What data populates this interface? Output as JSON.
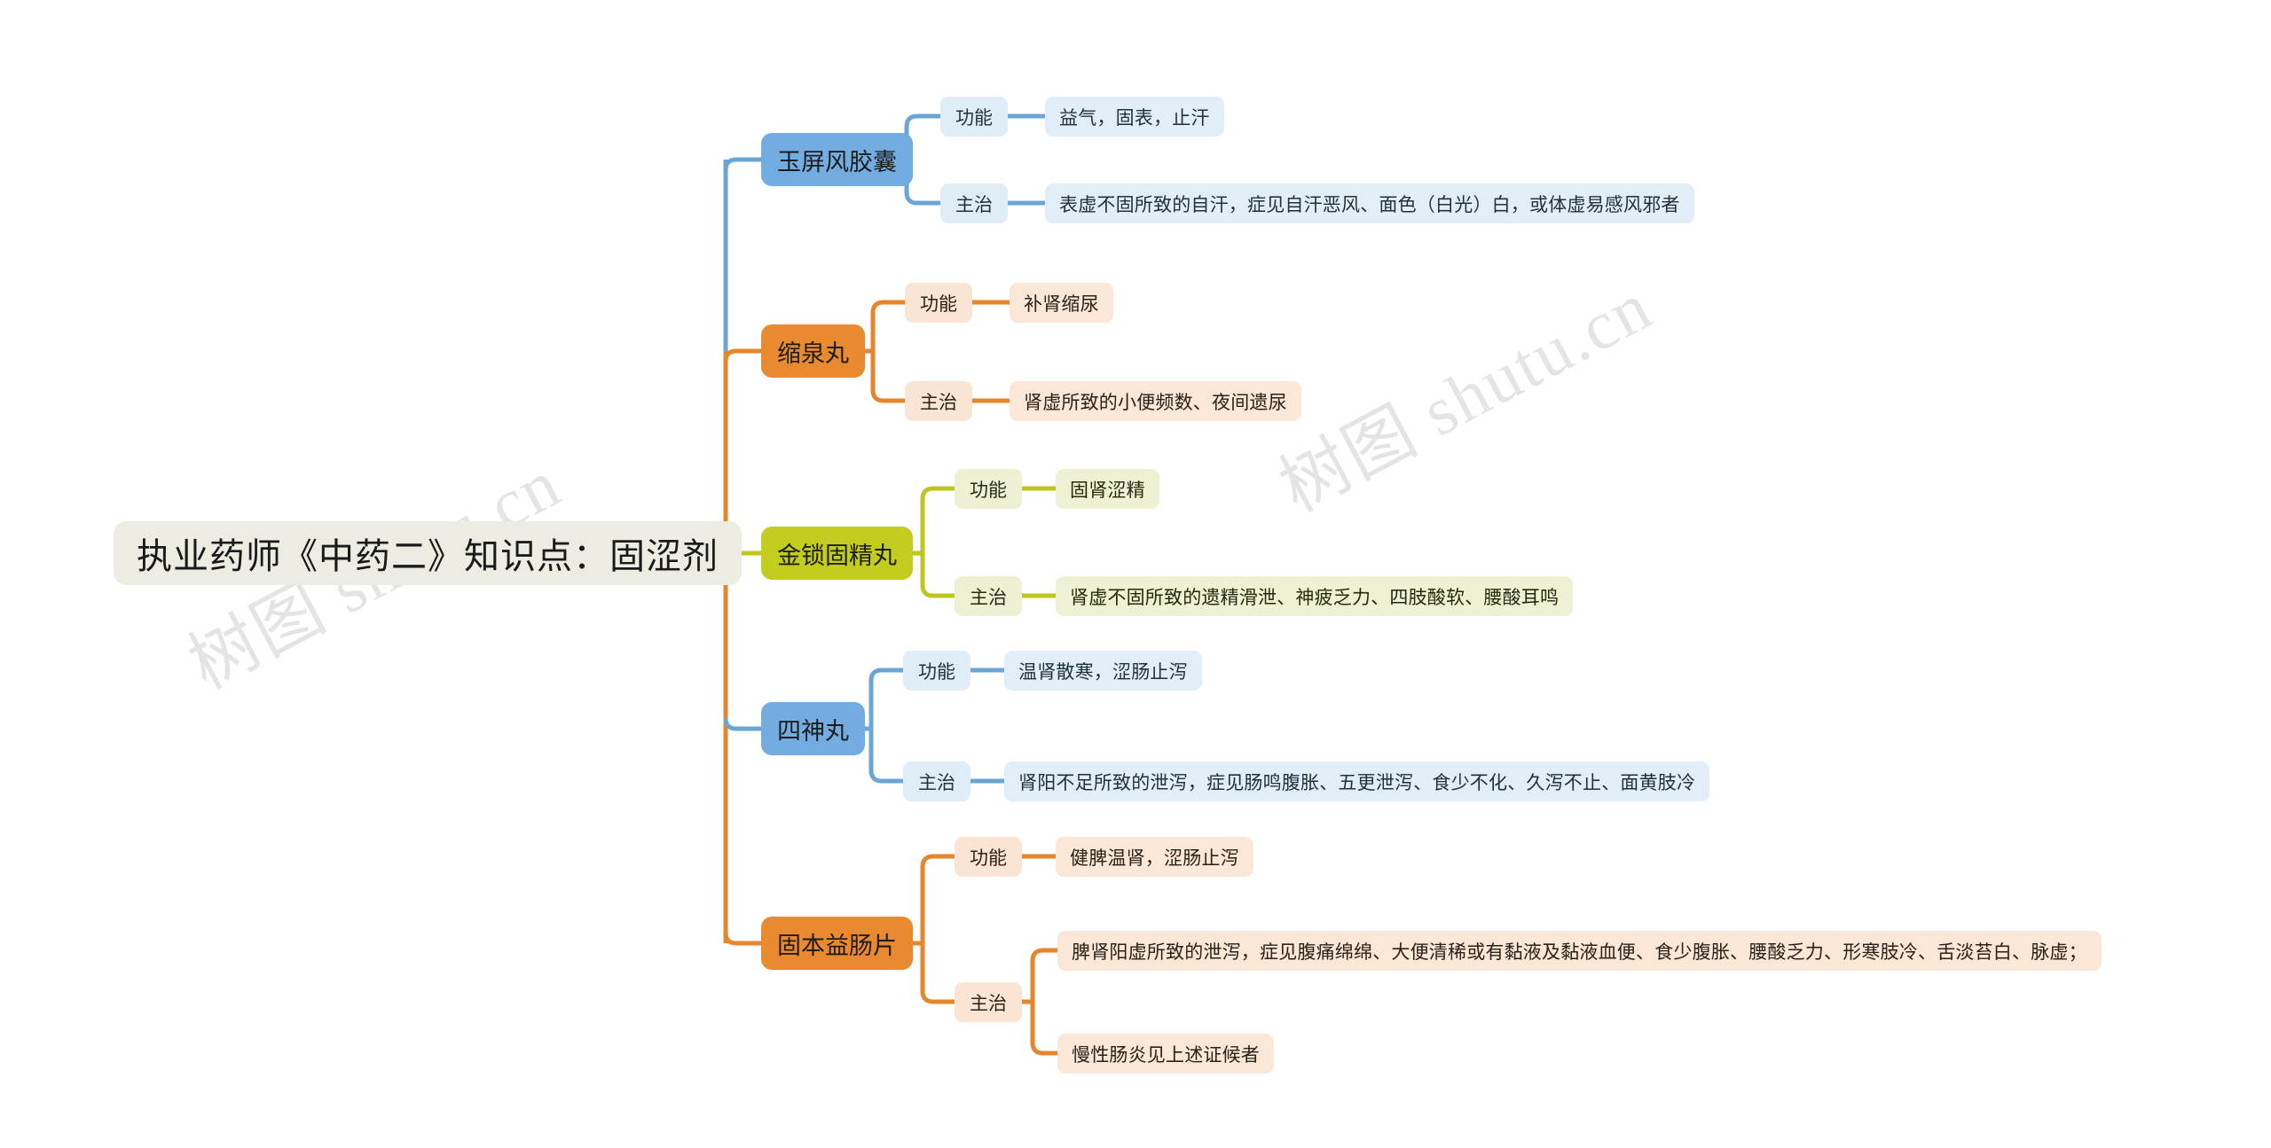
{
  "meta": {
    "watermark_1": "树图 shutu.cn",
    "watermark_2": "树图 shutu.cn"
  },
  "root": {
    "label": "执业药师《中药二》知识点：固涩剂",
    "color": "#ecece0"
  },
  "keys": {
    "function": "功能",
    "indication": "主治"
  },
  "branches": [
    {
      "id": "yupingfeng",
      "topic": "玉屏风胶囊",
      "color": "#72ace0",
      "line_color": "#6aa5d6",
      "function_label": "功能",
      "function_value": "益气，固表，止汗",
      "indication_label": "主治",
      "indication_values": [
        "表虚不固所致的自汗，症见自汗恶风、面色（白光）白，或体虚易感风邪者"
      ]
    },
    {
      "id": "suoquanwan",
      "topic": "缩泉丸",
      "color": "#ea8a30",
      "line_color": "#e5862c",
      "function_label": "功能",
      "function_value": "补肾缩尿",
      "indication_label": "主治",
      "indication_values": [
        "肾虚所致的小便频数、夜间遗尿"
      ]
    },
    {
      "id": "jinsuogujingwan",
      "topic": "金锁固精丸",
      "color": "#c3cd1e",
      "line_color": "#bcc61c",
      "function_label": "功能",
      "function_value": "固肾涩精",
      "indication_label": "主治",
      "indication_values": [
        "肾虚不固所致的遗精滑泄、神疲乏力、四肢酸软、腰酸耳鸣"
      ]
    },
    {
      "id": "sishenwan",
      "topic": "四神丸",
      "color": "#72ace0",
      "line_color": "#6aa5d6",
      "function_label": "功能",
      "function_value": "温肾散寒，涩肠止泻",
      "indication_label": "主治",
      "indication_values": [
        "肾阳不足所致的泄泻，症见肠鸣腹胀、五更泄泻、食少不化、久泻不止、面黄肢冷"
      ]
    },
    {
      "id": "gubenyichangpian",
      "topic": "固本益肠片",
      "color": "#ea8a30",
      "line_color": "#e5862c",
      "function_label": "功能",
      "function_value": "健脾温肾，涩肠止泻",
      "indication_label": "主治",
      "indication_values": [
        "脾肾阳虚所致的泄泻，症见腹痛绵绵、大便清稀或有黏液及黏液血便、食少腹胀、腰酸乏力、形寒肢冷、舌淡苔白、脉虚；",
        "慢性肠炎见上述证候者"
      ]
    }
  ]
}
